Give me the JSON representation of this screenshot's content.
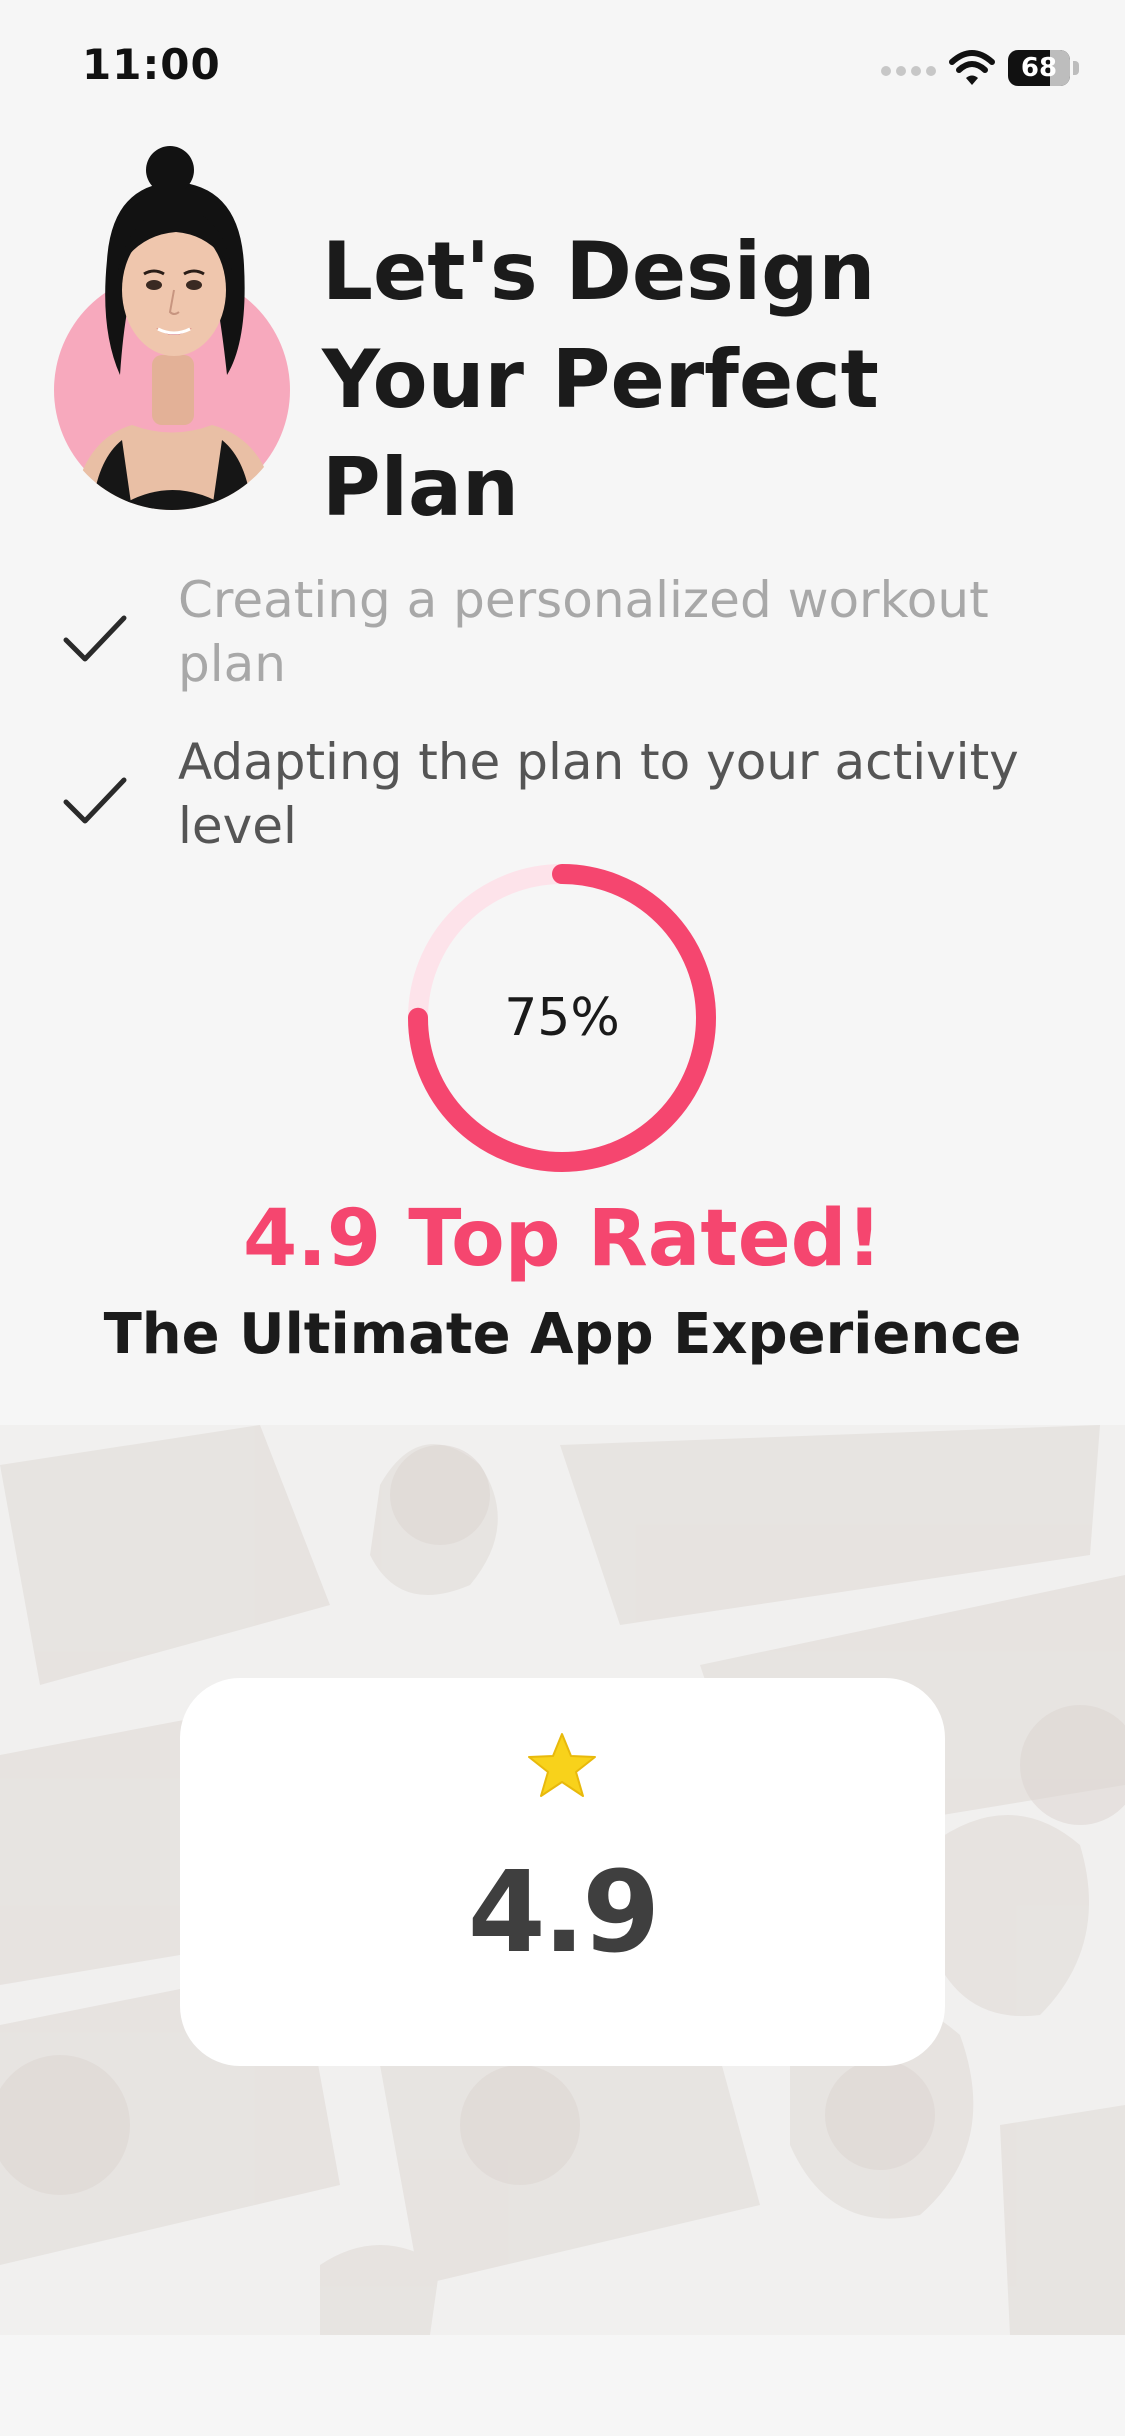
{
  "status_bar": {
    "time": "11:00",
    "battery_level": "68",
    "battery_fraction": 0.68,
    "icons": [
      "cellular-signal-icon",
      "wifi-icon",
      "battery-icon"
    ]
  },
  "header": {
    "title": "Let's Design Your Perfect Plan",
    "avatar_icon": "coach-avatar"
  },
  "checklist": [
    {
      "label": "Creating a personalized workout plan",
      "state": "completed",
      "icon": "checkmark-icon"
    },
    {
      "label": "Adapting the plan to your activity level",
      "state": "completed",
      "icon": "checkmark-icon"
    }
  ],
  "progress": {
    "value": 0.75,
    "label": "75%"
  },
  "rating": {
    "headline": "4.9 Top Rated!",
    "subline": "The Ultimate App Experience",
    "card_score": "4.9",
    "star_icon": "star-icon"
  },
  "colors": {
    "accent": "#f5466f",
    "accent_track": "#fde3ea",
    "background": "#f6f6f6",
    "card": "#ffffff",
    "avatar_backdrop": "#f7a9bd",
    "star": "#f8d21b"
  }
}
